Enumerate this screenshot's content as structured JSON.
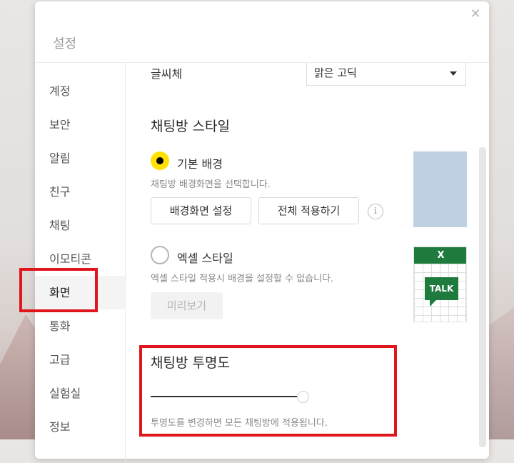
{
  "dialog": {
    "title": "설정",
    "close_icon": "close-icon"
  },
  "sidebar": {
    "items": [
      {
        "label": "계정"
      },
      {
        "label": "보안"
      },
      {
        "label": "알림"
      },
      {
        "label": "친구"
      },
      {
        "label": "채팅"
      },
      {
        "label": "이모티콘"
      },
      {
        "label": "화면",
        "active": true
      },
      {
        "label": "통화"
      },
      {
        "label": "고급"
      },
      {
        "label": "실험실"
      },
      {
        "label": "정보"
      }
    ]
  },
  "content": {
    "font": {
      "label": "글씨체",
      "selected": "맑은 고딕"
    },
    "chat_style": {
      "title": "채팅방 스타일",
      "basic": {
        "label": "기본 배경",
        "selected": true,
        "desc": "채팅방 배경화면을 선택합니다.",
        "btn_set_bg": "배경화면 설정",
        "btn_apply_all": "전체 적용하기",
        "info_icon": "i"
      },
      "excel": {
        "label": "엑셀 스타일",
        "selected": false,
        "desc": "엑셀 스타일 적용시 배경을 설정할 수 없습니다.",
        "btn_preview": "미리보기",
        "thumb_header": "X",
        "thumb_bubble": "TALK"
      }
    },
    "transparency": {
      "title": "채팅방 투명도",
      "value_fraction": 1.0,
      "desc": "투명도를 변경하면 모든 채팅방에 적용됩니다."
    }
  },
  "colors": {
    "accent_radio": "#ffe000",
    "highlight": "#e0161d",
    "excel_green": "#1f7a3e",
    "preview_blue": "#bfd0e2"
  }
}
